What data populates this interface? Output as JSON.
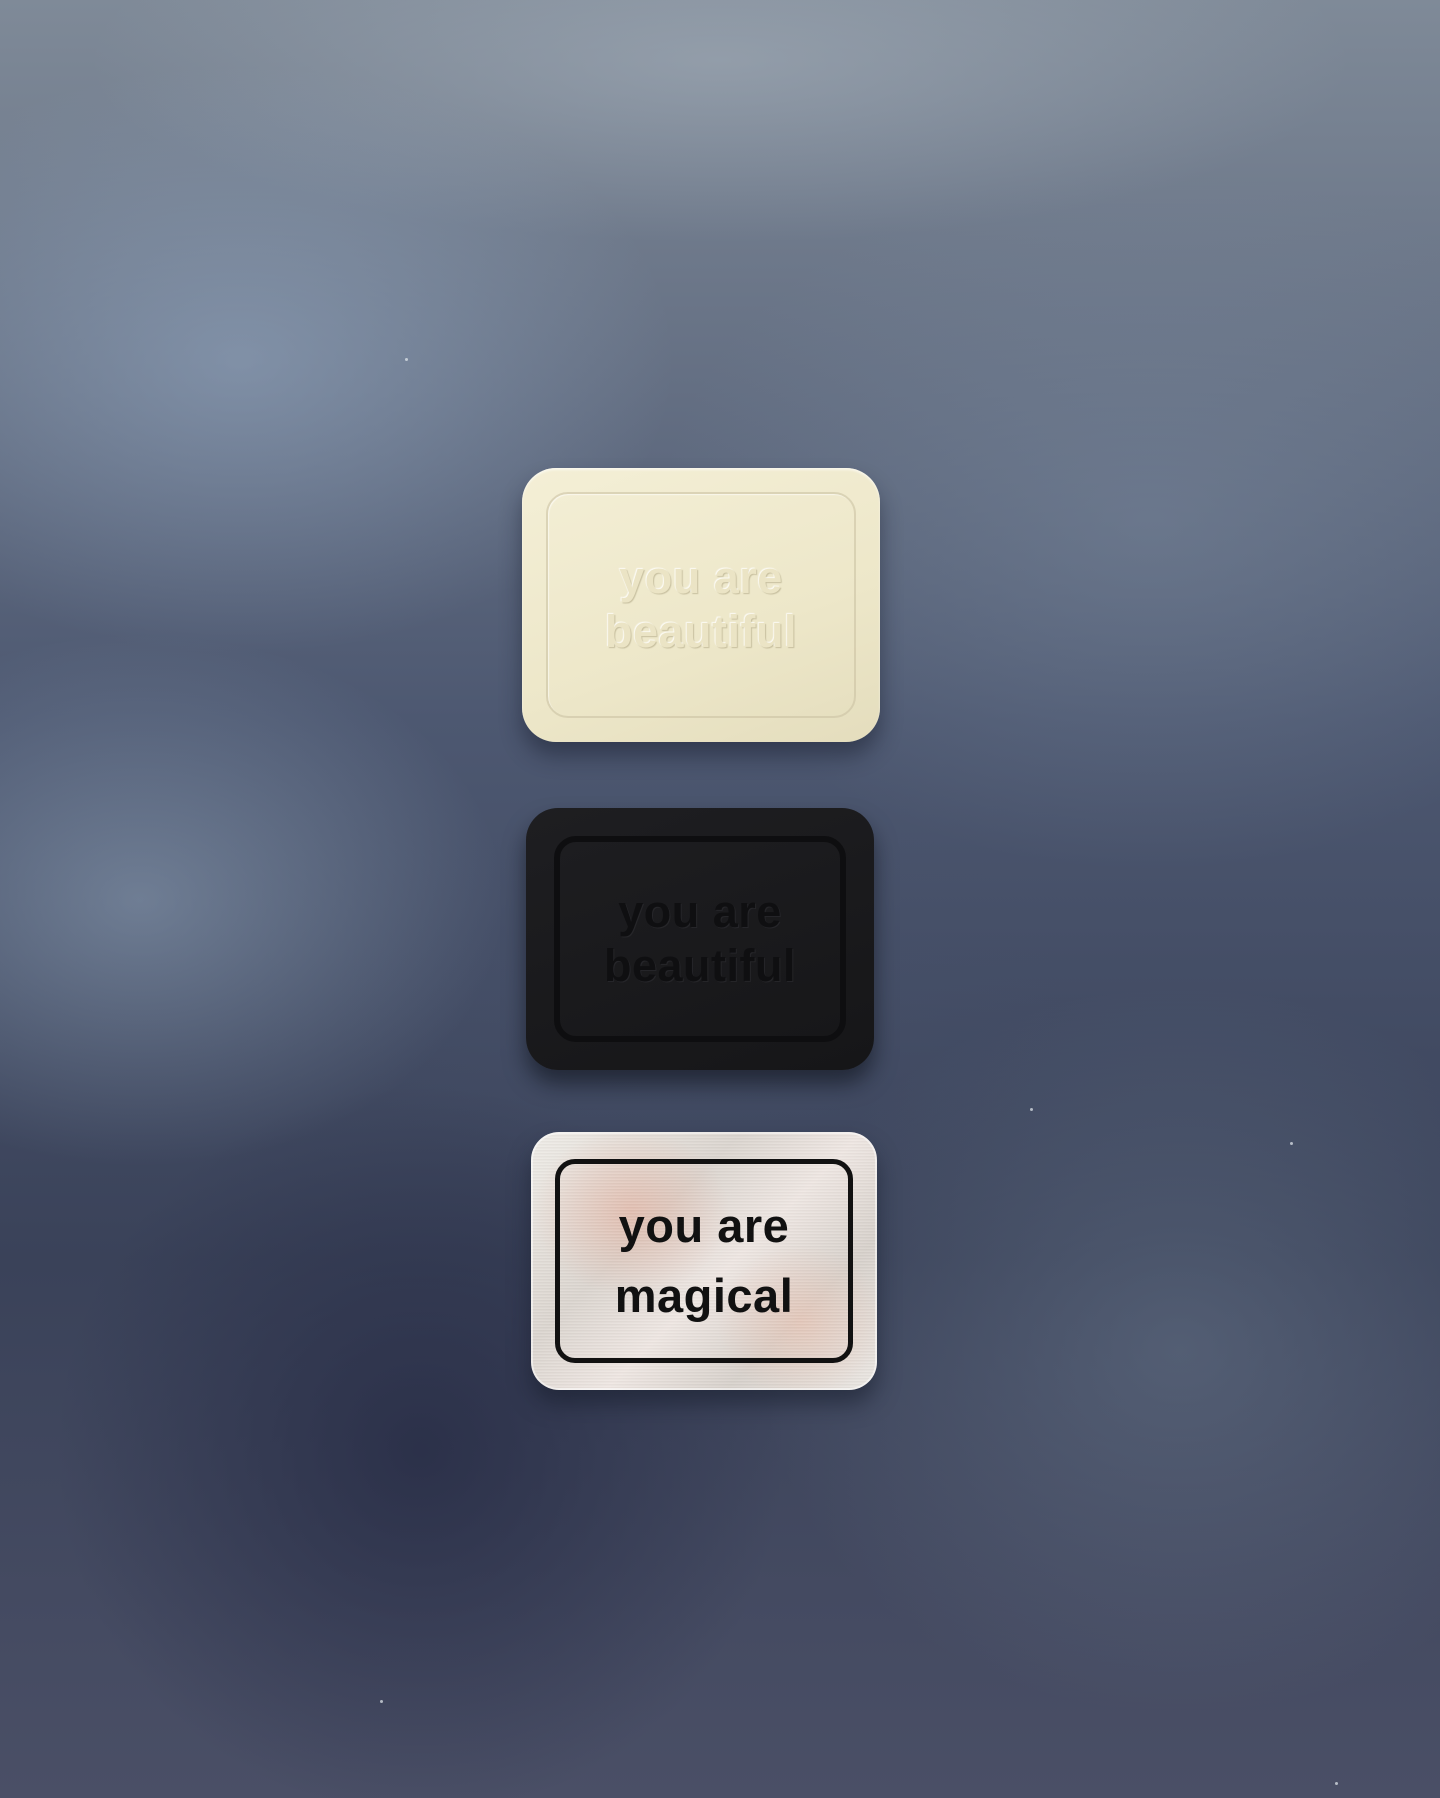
{
  "scene": {
    "description_colors": {
      "background": "#4d5871",
      "cream_plaque": "#ede7c9",
      "black_plaque": "#1a1a1c",
      "silver_plaque": "#e6e1dc"
    }
  },
  "plaques": [
    {
      "material": "cream",
      "line1": "you are",
      "line2": "beautiful"
    },
    {
      "material": "black",
      "line1": "you are",
      "line2": "beautiful"
    },
    {
      "material": "silver",
      "line1": "you are",
      "line2": "magical"
    }
  ]
}
